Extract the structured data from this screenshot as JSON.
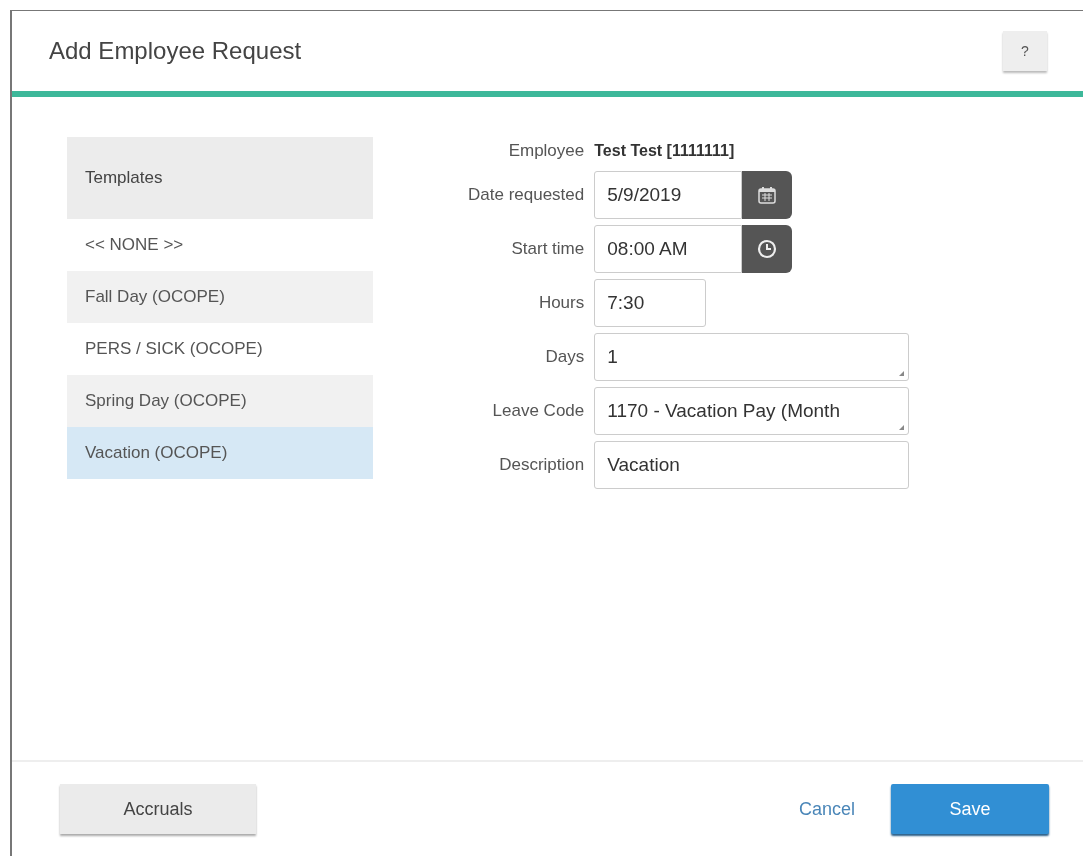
{
  "dialog": {
    "title": "Add Employee Request",
    "help_button": "?"
  },
  "templates": {
    "heading": "Templates",
    "items": [
      {
        "label": "<< NONE >>",
        "selected": false
      },
      {
        "label": "Fall Day (OCOPE)",
        "selected": false
      },
      {
        "label": "PERS / SICK (OCOPE)",
        "selected": false
      },
      {
        "label": "Spring Day (OCOPE)",
        "selected": false
      },
      {
        "label": "Vacation (OCOPE)",
        "selected": true
      }
    ]
  },
  "form": [
    {
      "kind": "text",
      "label": "Employee",
      "value": "Test Test [1111111]"
    },
    {
      "kind": "date",
      "label": "Date requested",
      "value": "5/9/2019"
    },
    {
      "kind": "time",
      "label": "Start time",
      "value": "08:00 AM"
    },
    {
      "kind": "short",
      "label": "Hours",
      "value": "7:30"
    },
    {
      "kind": "resizable",
      "label": "Days",
      "value": "1"
    },
    {
      "kind": "resizable",
      "label": "Leave Code",
      "value": "1170 - Vacation Pay (Month"
    },
    {
      "kind": "wide",
      "label": "Description",
      "value": "Vacation"
    }
  ],
  "footer": {
    "accruals": "Accruals",
    "cancel": "Cancel",
    "save": "Save"
  }
}
